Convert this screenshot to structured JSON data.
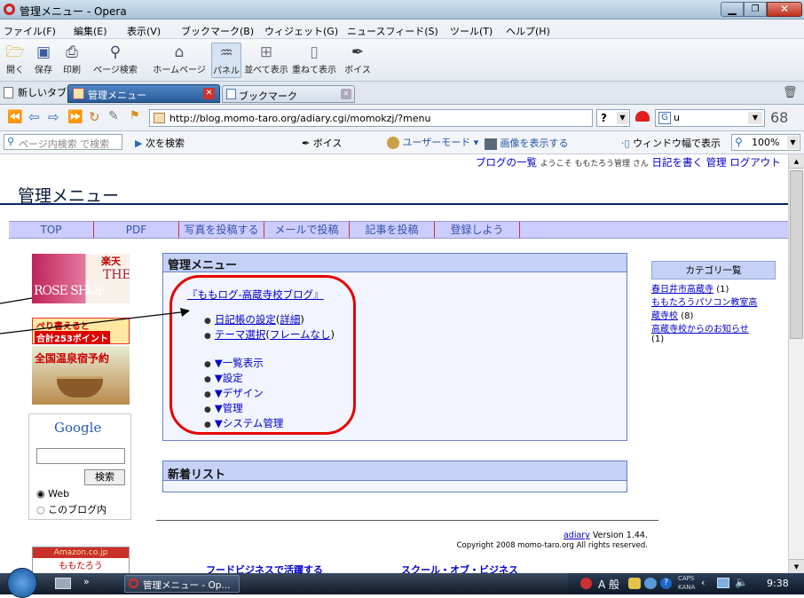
{
  "window": {
    "title": "管理メニュー - Opera"
  },
  "menubar": [
    "ファイル(F)",
    "編集(E)",
    "表示(V)",
    "ブックマーク(B)",
    "ウィジェット(G)",
    "ニュースフィード(S)",
    "ツール(T)",
    "ヘルプ(H)"
  ],
  "toolbar": {
    "open": "開く",
    "save": "保存",
    "print": "印刷",
    "page_search": "ページ検索",
    "home": "ホームページ",
    "panel": "パネル",
    "tile": "並べて表示",
    "cascade": "重ねて表示",
    "voice": "ボイス"
  },
  "tabs": {
    "new_tab": "新しいタブ",
    "tab1": "管理メニュー",
    "tab2": "ブックマーク"
  },
  "address": {
    "url": "http://blog.momo-taro.org/adiary.cgi/momokzj/?menu",
    "search_value": "u",
    "zoom_glyph": "68",
    "help_glyph": "?"
  },
  "findbar": {
    "placeholder": "ページ内検索 で検索",
    "find_next": "次を検索",
    "voice": "ボイス",
    "user_mode": "ユーザーモード",
    "show_images": "画像を表示する",
    "fit_width": "ウィンドウ幅で表示",
    "zoom": "100%"
  },
  "page": {
    "top_links": {
      "blog_list": "ブログの一覧",
      "welcome": "ようこそ ももたろう管理 さん",
      "write": "日記を書く",
      "admin": "管理",
      "logout": "ログアウト"
    },
    "title": "管理メニュー",
    "nav": [
      "TOP",
      "PDF",
      "写真を投稿する",
      "メールで投稿",
      "記事を投稿",
      "登録しよう"
    ],
    "ads": {
      "rakuten": "楽天",
      "the": "THE",
      "rose_shop": "ROSE SHOP",
      "points": "合計253ポイント",
      "points_pre": "ぺり書えると",
      "onsen": "全国温泉宿予約",
      "amazon": "Amazon.co.jp",
      "amazon_title": "ももたろう"
    },
    "google": {
      "logo": "Google",
      "search_button": "検索",
      "opt_web": "Web",
      "opt_blog": "このブログ内"
    },
    "admin_box": {
      "header": "管理メニュー",
      "blog_title": "『ももログ-高蔵寺校ブログ』",
      "link_settings": "日記帳の設定",
      "link_detail": "詳細",
      "link_theme": "テーマ選択",
      "link_noframe": "フレームなし",
      "items": [
        "▼一覧表示",
        "▼設定",
        "▼デザイン",
        "▼管理",
        "▼システム管理"
      ]
    },
    "new_box": {
      "header": "新着リスト"
    },
    "category": {
      "header": "カテゴリ一覧",
      "items": [
        {
          "name1": "春日井市高蔵寺",
          "count1": "(1)"
        },
        {
          "name1": "ももたろうパソコン教室高",
          "name2": "蔵寺校",
          "count2": "(8)"
        },
        {
          "name1": "高蔵寺校からのお知らせ",
          "count2": "(1)"
        }
      ]
    },
    "footer": {
      "adiary": "adiary",
      "version": "Version 1.44.",
      "copyright": "Copyright 2008 momo-taro.org All rights reserved.",
      "link1": "フードビジネスで活躍する",
      "link2": "スクール・オブ・ビジネス"
    }
  },
  "taskbar": {
    "task": "管理メニュー - Op...",
    "ime": "A 般",
    "clock": "9:38",
    "caps": "CAPS",
    "kana": "KANA"
  },
  "colors": {
    "title_blue": "#0a246a",
    "nav_bg": "#ccccff",
    "box_header": "#c5d2f5",
    "annotation_red": "#e60000",
    "link": "#0000cc"
  }
}
